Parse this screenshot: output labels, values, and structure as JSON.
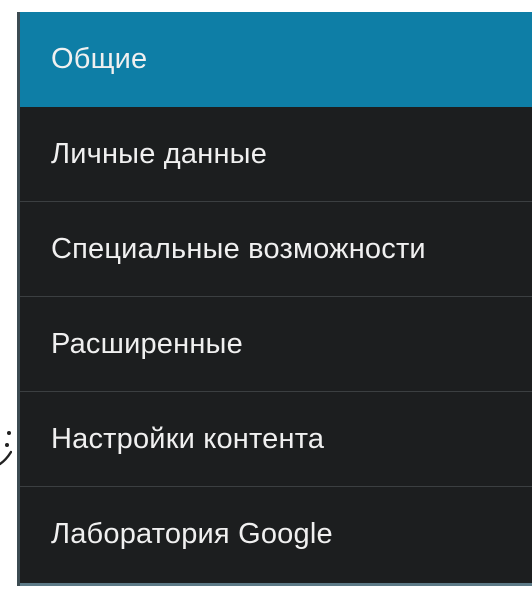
{
  "menu": {
    "items": [
      {
        "label": "Общие",
        "selected": true
      },
      {
        "label": "Личные данные",
        "selected": false
      },
      {
        "label": "Специальные возможности",
        "selected": false
      },
      {
        "label": "Расширенные",
        "selected": false
      },
      {
        "label": "Настройки контента",
        "selected": false
      },
      {
        "label": "Лаборатория Google",
        "selected": false
      }
    ]
  },
  "colors": {
    "selected_bg": "#0e7ea6",
    "panel_bg": "#1c1e1f",
    "divider": "#3b3f41",
    "text": "#f0f0f0"
  }
}
